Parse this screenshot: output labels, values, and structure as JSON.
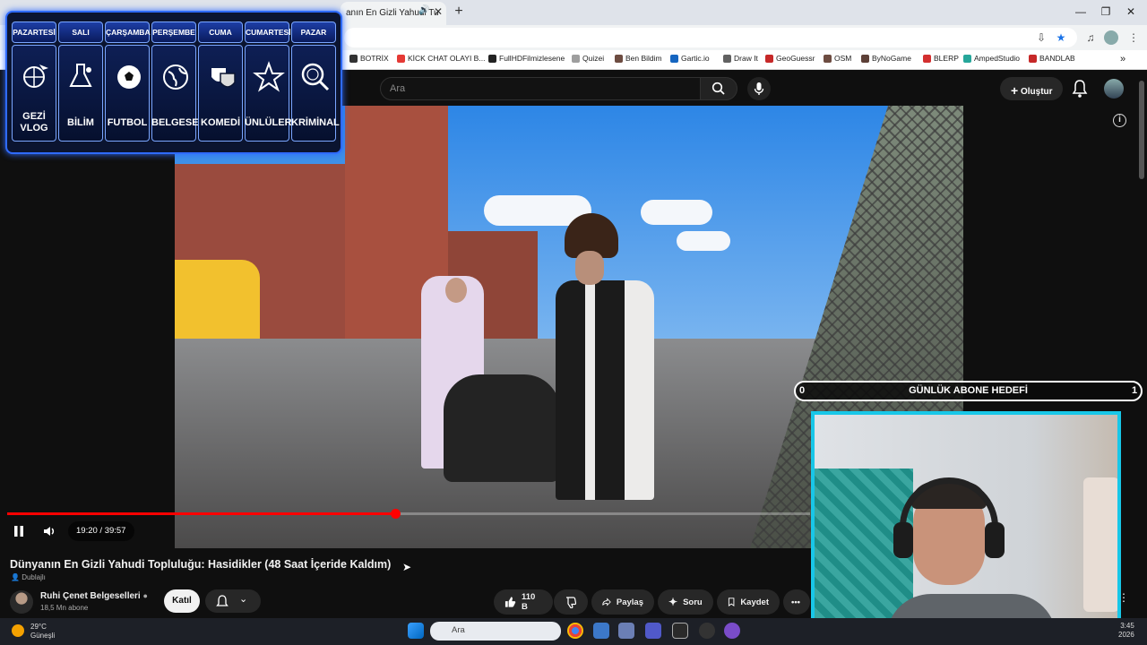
{
  "browser": {
    "tab_title": "anın En Gizli Yahudi Tu",
    "bookmarks": [
      "BOTRİX",
      "KİCK CHAT OLAYI B...",
      "FullHDFilmizlesene",
      "Quizei",
      "Ben Bildim",
      "Gartic.io",
      "Draw It",
      "GeoGuessr",
      "OSM",
      "ByNoGame",
      "BLERP",
      "AmpedStudio",
      "BANDLAB"
    ],
    "bookmark_colors": [
      "#333333",
      "#e53935",
      "#222222",
      "#9e9e9e",
      "#6d4c41",
      "#1565c0",
      "#616161",
      "#c62828",
      "#6d4c41",
      "#5d4037",
      "#d32f2f",
      "#26a69a",
      "#c62828"
    ]
  },
  "youtube": {
    "search_placeholder": "Ara",
    "create_label": "Oluştur",
    "time_display": "19:20 / 39:57",
    "progress_fraction": 0.4838,
    "video_title": "Dünyanın En Gizli Yahudi Topluluğu: Hasidikler (48 Saat İçeride Kaldım)",
    "dubbed_label": "Dublajlı",
    "channel_name": "Ruhi Çenet Belgeselleri",
    "channel_subs": "18,5 Mn abone",
    "join_label": "Katıl",
    "like_count": "110 B",
    "share_label": "Paylaş",
    "ask_label": "Soru",
    "save_label": "Kaydet"
  },
  "schedule": {
    "days": [
      "PAZARTESİ",
      "SALI",
      "ÇARŞAMBA",
      "PERŞEMBE",
      "CUMA",
      "CUMARTESİ",
      "PAZAR"
    ],
    "labels": [
      "GEZİ VLOG",
      "BİLİM",
      "FUTBOL",
      "BELGESEL",
      "KOMEDİ",
      "ÜNLÜLER",
      "KRİMİNAL"
    ],
    "icons": [
      "globe-plane-icon",
      "science-flask-icon",
      "soccer-ball-icon",
      "earth-globe-icon",
      "theater-masks-icon",
      "star-icon",
      "fingerprint-magnifier-icon"
    ]
  },
  "goal": {
    "title": "GÜNLÜK ABONE HEDEFİ",
    "current": "0",
    "target": "1"
  },
  "taskbar": {
    "temperature": "29°C",
    "weather": "Güneşli",
    "search_placeholder": "Ara",
    "time": "3:45",
    "date": "2026"
  },
  "colors": {
    "accent_red": "#ff0000",
    "overlay_blue": "#2f6bff",
    "webcam_border": "#18c7e8"
  }
}
